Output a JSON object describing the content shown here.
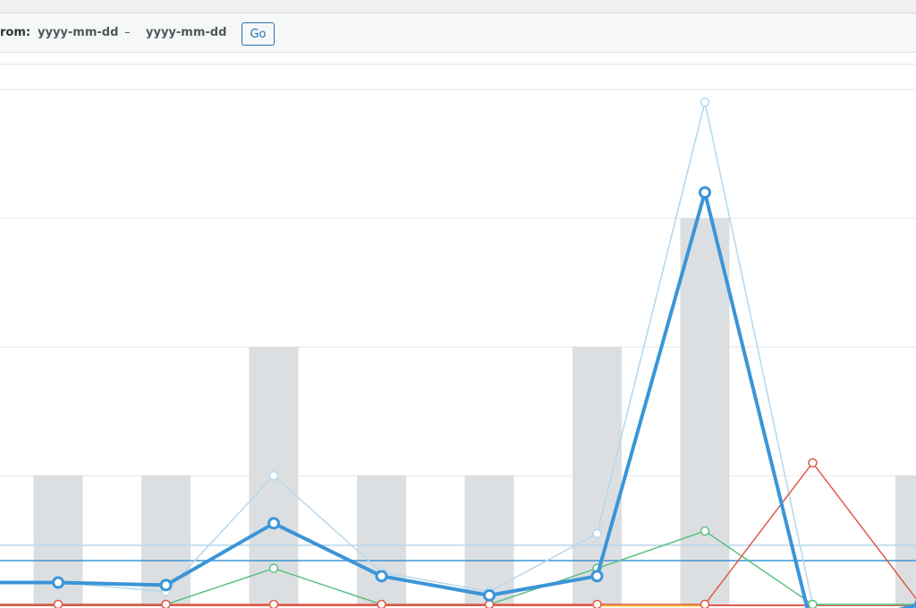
{
  "filter": {
    "label": "rom:",
    "start_placeholder": "yyyy-mm-dd",
    "separator": "–",
    "end_placeholder": "yyyy-mm-dd",
    "go_label": "Go"
  },
  "colors": {
    "bars": "#dcdfe1",
    "primary_line": "#3b95d8",
    "light_line": "#b6d7ec",
    "green_line": "#5cbf83",
    "red_line": "#e05a4a",
    "yellow_line": "#f0c63b",
    "grid": "#e4e4e4"
  },
  "chart_data": {
    "type": "bar",
    "x": [
      0,
      1,
      2,
      3,
      4,
      5,
      6,
      7,
      8,
      9,
      10
    ],
    "bars": [
      1,
      1,
      2,
      1,
      1,
      2,
      3,
      0,
      1,
      0,
      0
    ],
    "bar_indices": [
      0,
      1,
      2,
      3,
      4,
      5,
      6,
      8
    ],
    "y_ticks": [
      0,
      1,
      2,
      3,
      4
    ],
    "grid": true,
    "series": [
      {
        "key": "light",
        "values": [
          0.17,
          0.1,
          1.0,
          0.25,
          0.1,
          0.55,
          3.9,
          0.0,
          0.0,
          0.0,
          0.12
        ]
      },
      {
        "key": "primary",
        "values": [
          0.17,
          0.15,
          0.63,
          0.22,
          0.07,
          0.22,
          3.2,
          -0.2,
          0.0,
          0.0,
          0.1
        ]
      },
      {
        "key": "green",
        "values": [
          0.0,
          0.0,
          0.28,
          0.0,
          0.0,
          0.28,
          0.57,
          0.0,
          0.0,
          0.0,
          0.0
        ]
      },
      {
        "key": "red",
        "values": [
          0.0,
          0.0,
          0.0,
          0.0,
          0.0,
          0.0,
          0.0,
          1.1,
          0.0,
          0.0,
          0.0
        ]
      }
    ],
    "reference_lines": [
      {
        "key": "light",
        "value": 0.46
      },
      {
        "key": "primary",
        "value": 0.34
      }
    ]
  }
}
